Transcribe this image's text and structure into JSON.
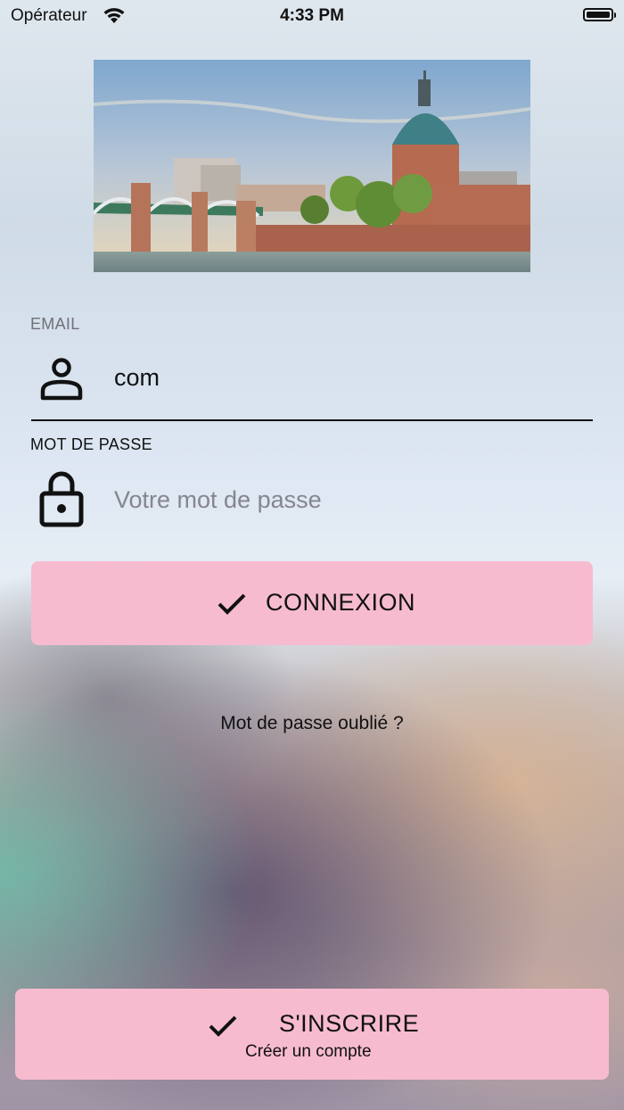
{
  "status_bar": {
    "carrier": "Opérateur",
    "time": "4:33 PM"
  },
  "form": {
    "email_label": "EMAIL",
    "email_value": "com",
    "password_label": "MOT DE PASSE",
    "password_placeholder": "Votre mot de passe"
  },
  "actions": {
    "login_label": "CONNEXION",
    "forgot_label": "Mot de passe oublié ?",
    "register_label": "S'INSCRIRE",
    "register_sublabel": "Créer un compte"
  },
  "icons": {
    "email": "person-icon",
    "password": "lock-icon",
    "login": "checkmark-icon",
    "register": "checkmark-icon"
  },
  "colors": {
    "button": "#f7bbcf",
    "text": "#111111",
    "muted_label": "#707078"
  }
}
